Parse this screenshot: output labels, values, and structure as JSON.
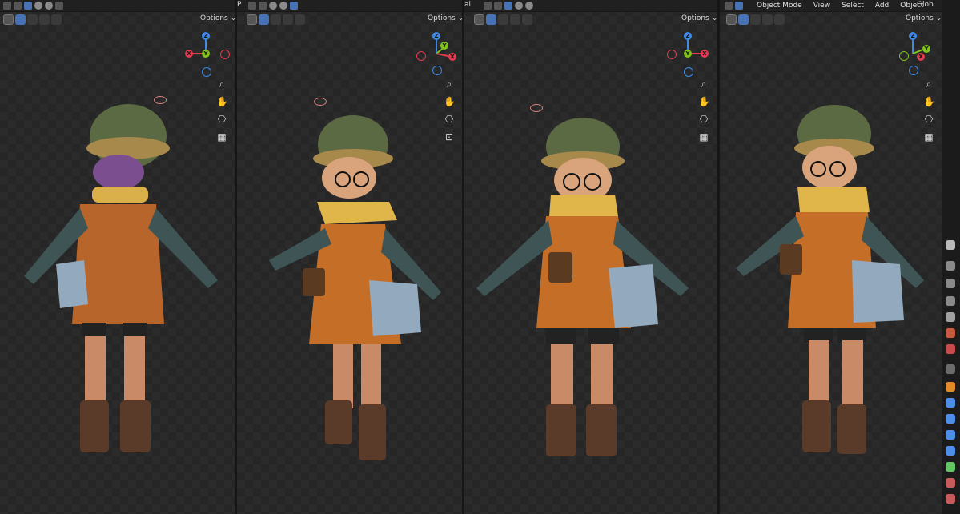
{
  "header": {
    "options_label": "Options",
    "chevron": "⌄",
    "menu_mode": "Object Mode",
    "menu_items": [
      "View",
      "Select",
      "Add",
      "Object"
    ],
    "transform_label": "Glob",
    "cut_label_3": "al",
    "cut_label_2": "P"
  },
  "gizmo": {
    "x_label": "X",
    "y_label": "Y",
    "z_label": "Z"
  },
  "colors": {
    "x_axis": "#e23a4f",
    "y_axis": "#7fc21c",
    "z_axis": "#3d8ae6",
    "accent": "#4772b3",
    "viewport_bg": "#2b2b2b"
  },
  "tools": {
    "zoom": "zoom-icon",
    "pan": "hand-icon",
    "camera": "camera-icon",
    "grid": "grid-icon",
    "lock": "lock-icon"
  },
  "character_views": [
    "back-view",
    "three-quarter-left-view",
    "front-view",
    "three-quarter-right-view"
  ]
}
